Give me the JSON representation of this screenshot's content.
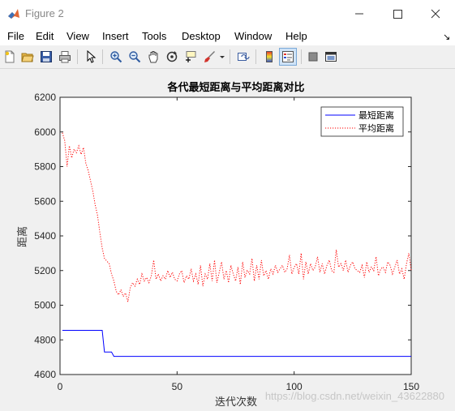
{
  "window": {
    "title": "Figure 2",
    "controls": [
      "minimize",
      "maximize",
      "close"
    ]
  },
  "menu": {
    "items": [
      "File",
      "Edit",
      "View",
      "Insert",
      "Tools",
      "Desktop",
      "Window",
      "Help"
    ],
    "dock_arrow": "↘"
  },
  "toolbar": {
    "icons": [
      "new-figure-icon",
      "open-icon",
      "save-icon",
      "print-icon",
      "pointer-icon",
      "zoom-in-icon",
      "zoom-out-icon",
      "pan-icon",
      "rotate-icon",
      "data-cursor-icon",
      "brush-icon",
      "link-plot-icon",
      "colorbar-icon",
      "legend-icon",
      "hide-plot-tools-icon",
      "show-plot-tools-icon"
    ]
  },
  "watermark": "https://blog.csdn.net/weixin_43622880",
  "chart_data": {
    "type": "line",
    "title": "各代最短距离与平均距离对比",
    "xlabel": "迭代次数",
    "ylabel": "距离",
    "xlim": [
      0,
      150
    ],
    "ylim": [
      4600,
      6200
    ],
    "xticks": [
      0,
      50,
      100,
      150
    ],
    "yticks": [
      4600,
      4800,
      5000,
      5200,
      5400,
      5600,
      5800,
      6000,
      6200
    ],
    "legend_position": "top-right",
    "grid": false,
    "series": [
      {
        "name": "最短距离",
        "style": "solid",
        "color": "#0000ff",
        "x": [
          1,
          18,
          19,
          22,
          23,
          150
        ],
        "y": [
          4855,
          4855,
          4730,
          4730,
          4705,
          4705
        ]
      },
      {
        "name": "平均距离",
        "style": "dotted",
        "color": "#ff0000",
        "x": [
          1,
          2,
          3,
          4,
          5,
          6,
          7,
          8,
          9,
          10,
          11,
          12,
          13,
          14,
          15,
          16,
          17,
          18,
          19,
          20,
          21,
          22,
          23,
          24,
          25,
          26,
          27,
          28,
          29,
          30,
          31,
          32,
          33,
          34,
          35,
          36,
          37,
          38,
          39,
          40,
          41,
          42,
          43,
          44,
          45,
          46,
          47,
          48,
          49,
          50,
          51,
          52,
          53,
          54,
          55,
          56,
          57,
          58,
          59,
          60,
          61,
          62,
          63,
          64,
          65,
          66,
          67,
          68,
          69,
          70,
          71,
          72,
          73,
          74,
          75,
          76,
          77,
          78,
          79,
          80,
          81,
          82,
          83,
          84,
          85,
          86,
          87,
          88,
          89,
          90,
          91,
          92,
          93,
          94,
          95,
          96,
          97,
          98,
          99,
          100,
          101,
          102,
          103,
          104,
          105,
          106,
          107,
          108,
          109,
          110,
          111,
          112,
          113,
          114,
          115,
          116,
          117,
          118,
          119,
          120,
          121,
          122,
          123,
          124,
          125,
          126,
          127,
          128,
          129,
          130,
          131,
          132,
          133,
          134,
          135,
          136,
          137,
          138,
          139,
          140,
          141,
          142,
          143,
          144,
          145,
          146,
          147,
          148,
          149,
          150
        ],
        "y": [
          5995,
          5950,
          5800,
          5920,
          5850,
          5900,
          5880,
          5920,
          5870,
          5910,
          5820,
          5780,
          5720,
          5660,
          5580,
          5520,
          5420,
          5330,
          5270,
          5255,
          5240,
          5180,
          5140,
          5080,
          5060,
          5090,
          5050,
          5070,
          5020,
          5100,
          5130,
          5110,
          5150,
          5120,
          5180,
          5140,
          5160,
          5130,
          5170,
          5260,
          5150,
          5180,
          5140,
          5170,
          5150,
          5200,
          5160,
          5190,
          5150,
          5140,
          5180,
          5200,
          5130,
          5170,
          5150,
          5210,
          5140,
          5180,
          5120,
          5230,
          5110,
          5180,
          5150,
          5240,
          5140,
          5260,
          5130,
          5190,
          5250,
          5150,
          5200,
          5130,
          5230,
          5180,
          5140,
          5220,
          5120,
          5250,
          5160,
          5200,
          5180,
          5270,
          5140,
          5230,
          5150,
          5260,
          5170,
          5200,
          5150,
          5210,
          5180,
          5230,
          5190,
          5210,
          5230,
          5190,
          5210,
          5290,
          5180,
          5220,
          5240,
          5180,
          5300,
          5150,
          5250,
          5180,
          5240,
          5200,
          5220,
          5280,
          5190,
          5240,
          5180,
          5230,
          5260,
          5200,
          5190,
          5320,
          5220,
          5240,
          5200,
          5260,
          5190,
          5230,
          5250,
          5210,
          5200,
          5190,
          5230,
          5160,
          5250,
          5190,
          5220,
          5200,
          5280,
          5170,
          5210,
          5220,
          5190,
          5250,
          5230,
          5180,
          5220,
          5260,
          5180,
          5210,
          5150,
          5240,
          5300,
          5200
        ]
      }
    ]
  }
}
